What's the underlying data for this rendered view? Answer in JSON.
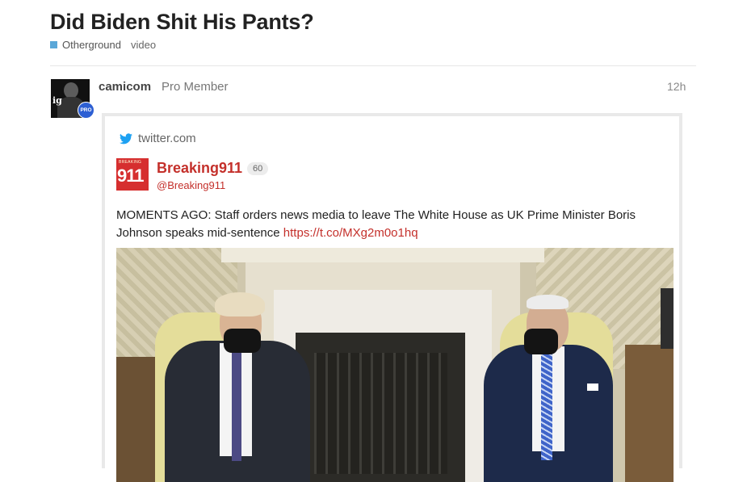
{
  "topic": {
    "title": "Did Biden Shit His Pants?",
    "category": {
      "name": "Otherground",
      "color": "#5aa7d8"
    },
    "tags": [
      "video"
    ]
  },
  "post": {
    "username": "camicom",
    "user_title": "Pro Member",
    "time": "12h",
    "avatar_badge": "PRO",
    "avatar_text": "ig"
  },
  "onebox": {
    "source": "twitter.com",
    "source_icon": "twitter-bird-icon",
    "account": {
      "name": "Breaking911",
      "handle": "@Breaking911",
      "count": "60",
      "avatar_small_text": "BREAKING",
      "avatar_big_text": "911"
    },
    "tweet_text": "MOMENTS AGO: Staff orders news media to leave The White House as UK Prime Minister Boris Johnson speaks mid-sentence ",
    "tweet_link": "https://t.co/MXg2m0o1hq"
  },
  "colors": {
    "link": "#c4302b",
    "twitter_blue": "#1da1f2",
    "pro_badge": "#2d5fd3"
  }
}
